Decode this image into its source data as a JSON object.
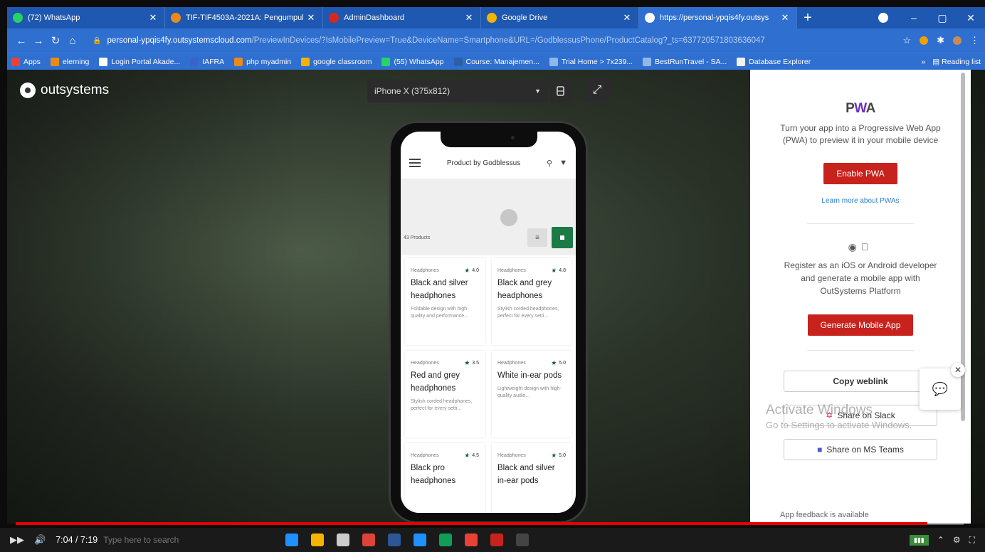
{
  "browser": {
    "tabs": [
      {
        "title": "(72) WhatsApp",
        "color": "#25d366",
        "active": false
      },
      {
        "title": "TIF-TIF4503A-2021A: Pengumpul",
        "color": "#e98a1a",
        "active": false
      },
      {
        "title": "AdminDashboard",
        "color": "#d6281e",
        "active": false
      },
      {
        "title": "Google Drive",
        "color": "#f4b400",
        "active": false
      },
      {
        "title": "https://personal-ypqis4fy.outsys",
        "color": "#ffffff",
        "active": true
      }
    ],
    "url_host": "personal-ypqis4fy.outsystemscloud.com",
    "url_path": "/PreviewInDevices/?IsMobilePreview=True&DeviceName=Smartphone&URL=/GodblessusPhone/ProductCatalog?_ts=637720571803636047",
    "bookmarks": [
      {
        "label": "Apps",
        "color": "#e94235"
      },
      {
        "label": "elerning",
        "color": "#e98a1a"
      },
      {
        "label": "Login Portal Akade...",
        "color": "#ffffff"
      },
      {
        "label": "IAFRA",
        "color": "#3866c7"
      },
      {
        "label": "php myadmin",
        "color": "#e98a1a"
      },
      {
        "label": "google classroom",
        "color": "#f4b400"
      },
      {
        "label": "(55) WhatsApp",
        "color": "#25d366"
      },
      {
        "label": "Course: Manajemen...",
        "color": "#2d5fa8"
      },
      {
        "label": "Trial Home > 7x239...",
        "color": "#8fb8e8"
      },
      {
        "label": "BestRunTravel - SA...",
        "color": "#8fb8e8"
      },
      {
        "label": "Database Explorer",
        "color": "#f2f2f2"
      }
    ],
    "reading_list": "Reading list"
  },
  "preview": {
    "brand": "outsystems",
    "device": "iPhone X (375x812)"
  },
  "app": {
    "title": "Product by Godblessus",
    "product_count": "43 Products",
    "products": [
      {
        "category": "Headphones",
        "rating": "4.0",
        "name": "Black and silver headphones",
        "desc": "Foldable design with high quality and performance..."
      },
      {
        "category": "Headphones",
        "rating": "4.8",
        "name": "Black and grey headphones",
        "desc": "Stylish corded headphones, perfect for every setti..."
      },
      {
        "category": "Headphones",
        "rating": "3.5",
        "name": "Red and grey headphones",
        "desc": "Stylish corded headphones, perfect for every setti..."
      },
      {
        "category": "Headphones",
        "rating": "5.0",
        "name": "White in-ear pods",
        "desc": "Lightweight design with high-quality audio..."
      },
      {
        "category": "Headphones",
        "rating": "4.5",
        "name": "Black pro headphones",
        "desc": ""
      },
      {
        "category": "Headphones",
        "rating": "5.0",
        "name": "Black and silver in-ear pods",
        "desc": ""
      }
    ]
  },
  "panel": {
    "pwa_logo_p": "P",
    "pwa_logo_w": "W",
    "pwa_logo_a": "A",
    "pwa_text": "Turn your app into a Progressive Web App (PWA) to preview it in your mobile device",
    "enable_pwa": "Enable PWA",
    "learn_more": "Learn more about PWAs",
    "register_text": "Register as an iOS or Android developer and generate a mobile app with OutSystems Platform",
    "generate_app": "Generate Mobile App",
    "copy_weblink": "Copy weblink",
    "share_slack": "Share on Slack",
    "share_teams": "Share on MS Teams",
    "feedback": "App feedback is available"
  },
  "watermark": {
    "line1": "Activate Windows",
    "line2": "Go to Settings to activate Windows."
  },
  "video": {
    "time": "7:04 / 7:19",
    "progress": 0.962
  },
  "taskbar": {
    "search_ghost": "Type here to search",
    "apps": [
      "#1e90ff",
      "#f4b400",
      "#cccccc",
      "#db4437",
      "#2b5797",
      "#1e90ff",
      "#0f9d58",
      "#e94235",
      "#c8221c",
      "#444444"
    ]
  }
}
